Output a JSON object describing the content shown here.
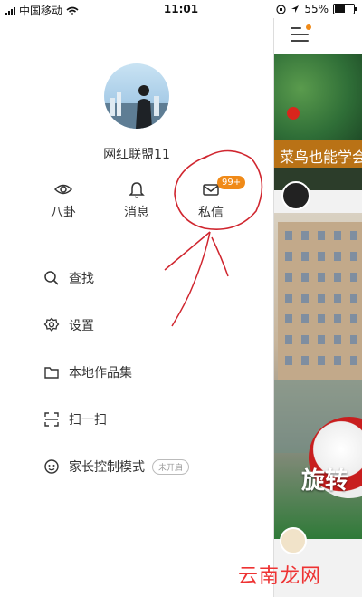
{
  "status_bar": {
    "carrier": "中国移动",
    "time": "11:01",
    "battery_percent": "55%",
    "battery_level": 0.55
  },
  "profile": {
    "username": "网红联盟11"
  },
  "quick_actions": [
    {
      "label": "八卦",
      "icon": "eye-icon"
    },
    {
      "label": "消息",
      "icon": "bell-icon"
    },
    {
      "label": "私信",
      "icon": "mail-icon",
      "badge": "99+"
    }
  ],
  "menu": [
    {
      "label": "查找",
      "icon": "search-icon"
    },
    {
      "label": "设置",
      "icon": "gear-icon"
    },
    {
      "label": "本地作品集",
      "icon": "folder-icon"
    },
    {
      "label": "扫一扫",
      "icon": "scan-icon"
    },
    {
      "label": "家长控制模式",
      "icon": "parental-icon",
      "tag": "未开启"
    }
  ],
  "feed": {
    "card1_title": "菜鸟也能学会",
    "card2_caption": "旋转"
  },
  "watermark": "云南龙网",
  "colors": {
    "accent": "#f08a18",
    "annotation": "#d0262f",
    "text": "#333333"
  }
}
